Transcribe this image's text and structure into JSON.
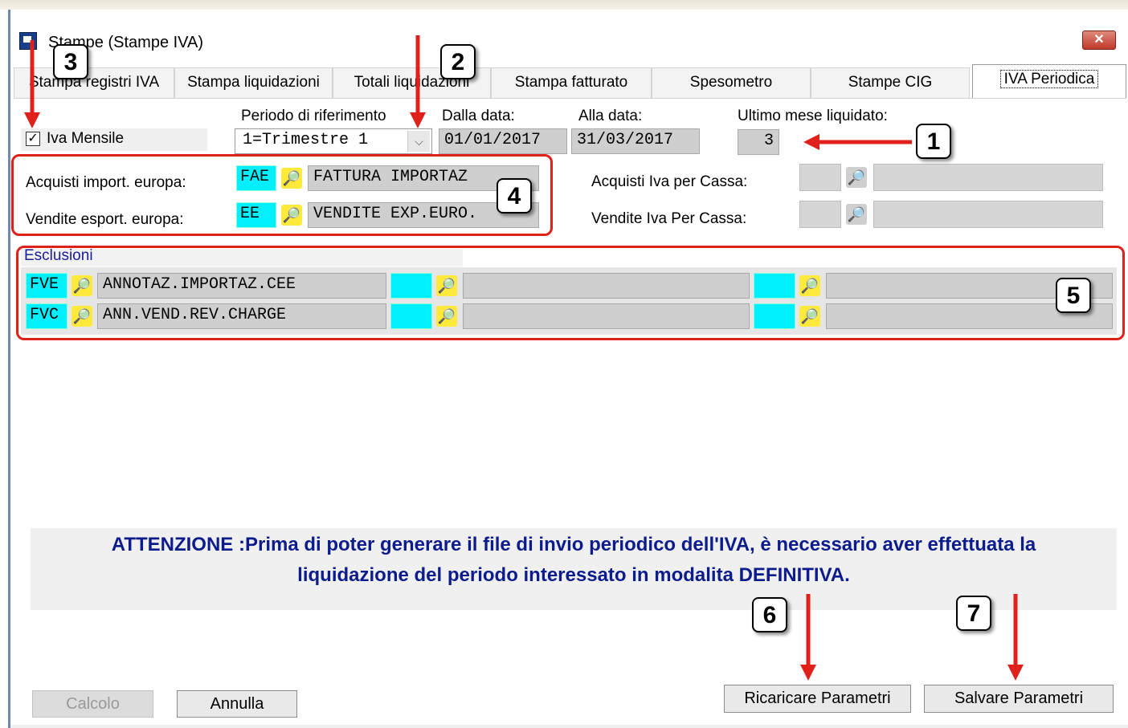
{
  "window": {
    "title": "Stampe (Stampe IVA)",
    "close_label": "✕"
  },
  "tabs": [
    {
      "label": "Stampa registri IVA"
    },
    {
      "label": "Stampa liquidazioni"
    },
    {
      "label": "Totali liquidazioni"
    },
    {
      "label": "Stampa fatturato"
    },
    {
      "label": "Spesometro"
    },
    {
      "label": "Stampe CIG"
    },
    {
      "label": "IVA Periodica",
      "active": true
    }
  ],
  "checkbox": {
    "label": "Iva Mensile",
    "checked": true,
    "mark": "✓"
  },
  "periodo": {
    "label": "Periodo di riferimento",
    "value": "1=Trimestre 1",
    "arrow": "⌵"
  },
  "dalla": {
    "label": "Dalla data:",
    "value": "01/01/2017"
  },
  "alla": {
    "label": "Alla data:",
    "value": "31/03/2017"
  },
  "ultimo": {
    "label": "Ultimo mese liquidato:",
    "value": "3"
  },
  "acquisti_import": {
    "label": "Acquisti import. europa:",
    "code": "FAE",
    "desc": "FATTURA IMPORTAZ"
  },
  "vendite_esport": {
    "label": "Vendite esport. europa:",
    "code": "EE",
    "desc": "VENDITE EXP.EURO."
  },
  "acquisti_cassa": {
    "label": "Acquisti Iva per Cassa:"
  },
  "vendite_cassa": {
    "label": "Vendite Iva Per Cassa:"
  },
  "esclusioni": {
    "label": "Esclusioni",
    "rows": [
      {
        "code": "FVE",
        "desc": "ANNOTAZ.IMPORTAZ.CEE"
      },
      {
        "code": "FVC",
        "desc": "ANN.VEND.REV.CHARGE"
      }
    ]
  },
  "warning": {
    "line1": "ATTENZIONE :Prima di poter generare il file di invio periodico dell'IVA, è necessario aver effettuata la",
    "line2": "liquidazione del periodo interessato in modalita DEFINITIVA."
  },
  "buttons": {
    "calcolo": "Calcolo",
    "annulla": "Annulla",
    "ricaricare": "Ricaricare Parametri",
    "salvare": "Salvare Parametri"
  },
  "lookup_icon": "binoculars-icon",
  "callouts": [
    "1",
    "2",
    "3",
    "4",
    "5",
    "6",
    "7"
  ],
  "colors": {
    "highlight": "#e0201a",
    "lookup_code_bg": "#00f0ff",
    "warning_text": "#0c1c8c"
  }
}
